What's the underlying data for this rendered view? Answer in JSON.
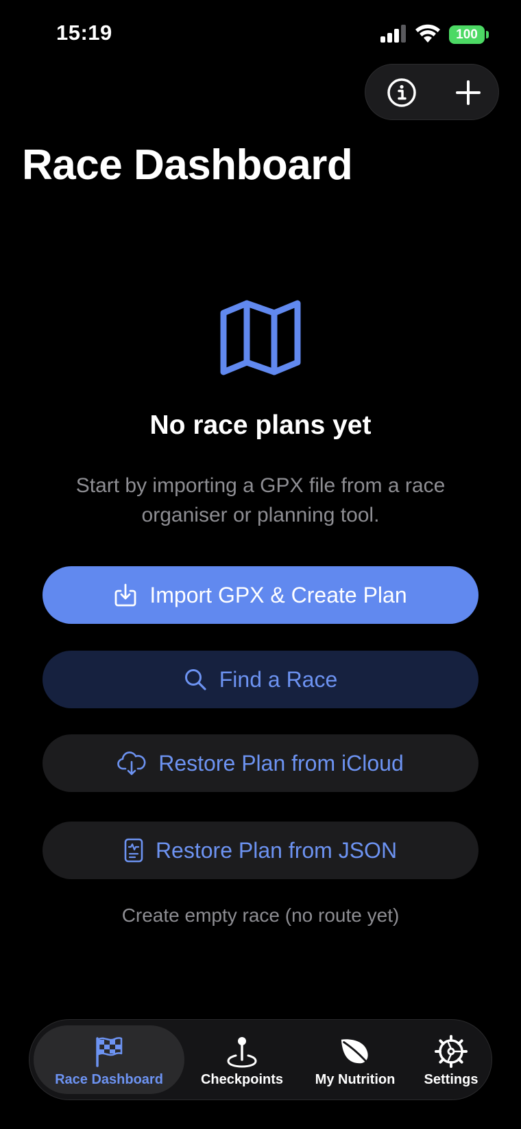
{
  "status_bar": {
    "time": "15:19",
    "battery": "100",
    "icons": [
      "signal-icon",
      "wifi-icon",
      "battery-icon"
    ]
  },
  "nav": {
    "info_icon": "info-circle-icon",
    "add_icon": "plus-icon"
  },
  "page": {
    "title": "Race Dashboard"
  },
  "empty_state": {
    "icon": "map-icon",
    "title": "No race plans yet",
    "description": "Start by importing a GPX file from a race organiser or planning tool."
  },
  "actions": {
    "import_label": "Import GPX & Create Plan",
    "find_label": "Find a Race",
    "icloud_label": "Restore Plan from iCloud",
    "json_label": "Restore Plan from JSON",
    "empty_race_label": "Create empty race (no route yet)"
  },
  "tabs": [
    {
      "label": "Race Dashboard",
      "icon": "checkered-flag-icon",
      "active": true
    },
    {
      "label": "Checkpoints",
      "icon": "map-pin-icon",
      "active": false
    },
    {
      "label": "My Nutrition",
      "icon": "leaf-icon",
      "active": false
    },
    {
      "label": "Settings",
      "icon": "gear-icon",
      "active": false
    }
  ],
  "colors": {
    "accent": "#6189ef",
    "accent_text": "#6d93f2",
    "background": "#000000",
    "secondary_text": "#8e8e93",
    "battery_green": "#4cd964"
  }
}
